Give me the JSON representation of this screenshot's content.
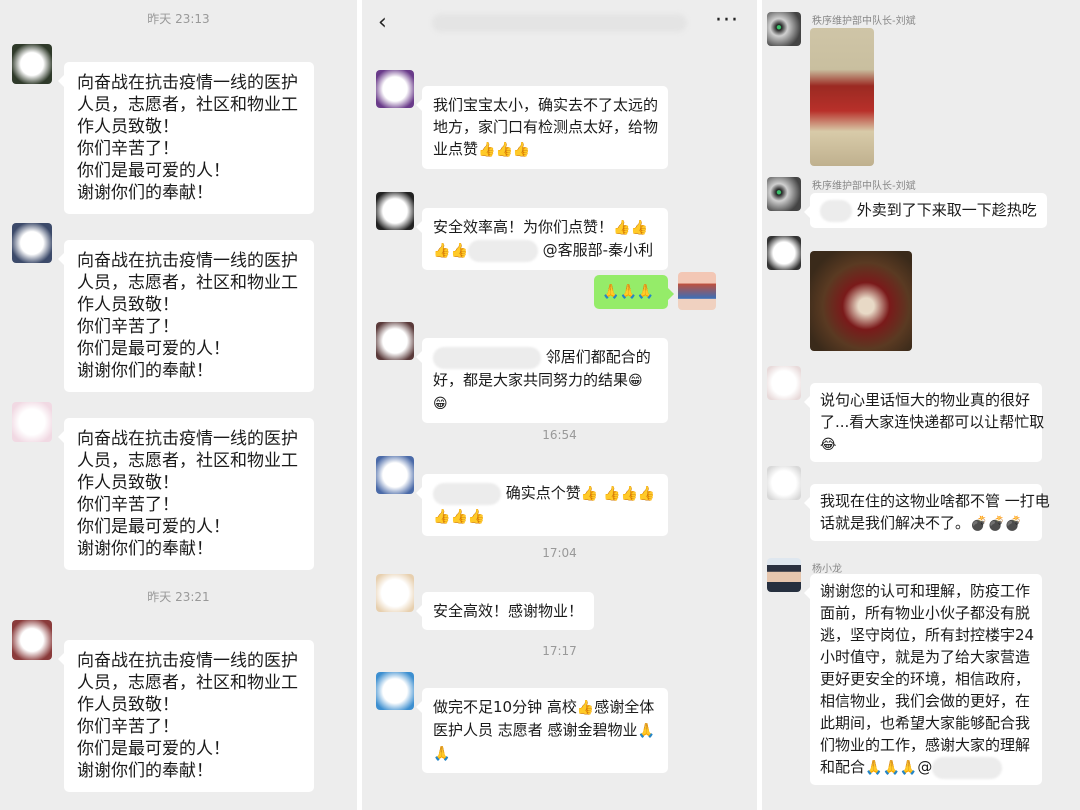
{
  "panel1": {
    "timestamps": [
      "昨天 23:13",
      "昨天 23:21"
    ],
    "message_lines": [
      "向奋战在抗击疫情一线的医护",
      "人员，志愿者，社区和物业工",
      "作人员致敬！",
      "你们辛苦了！",
      "你们是最可爱的人！",
      "谢谢你们的奉献！"
    ]
  },
  "panel2": {
    "header": {
      "back_icon": "‹",
      "more_icon": "···"
    },
    "messages": {
      "m1": [
        "我们宝宝太小，确实去不了太远的",
        "地方，家门口有检测点太好，给物",
        "业点赞"
      ],
      "m2a": "安全效率高！为你们点赞！",
      "m2b": "@客服部-秦小利",
      "m3a": "邻居们都配合的",
      "m3b": "好，都是大家共同努力的结果",
      "m4": "确实点个赞",
      "m5": "安全高效！感谢物业！",
      "m6a": "做完不足10分钟 高校",
      "m6b": "感谢全体",
      "m6c": "医护人员 志愿者 感谢金碧物业"
    },
    "timestamps": [
      "16:54",
      "17:04",
      "17:17"
    ],
    "emoji": {
      "thumbs": "👍",
      "pray": "🙏",
      "grin": "😁"
    }
  },
  "panel3": {
    "senders": {
      "liubin": "秩序维护部中队长-刘斌",
      "yang": "杨小龙"
    },
    "messages": {
      "m1": "外卖到了下来取一下趁热吃",
      "m2": [
        "说句心里话恒大的物业真的很好",
        "了...看大家连快递都可以让帮忙取"
      ],
      "m3": [
        "我现在住的这物业啥都不管 一打电",
        "话就是我们解决不了。"
      ],
      "m4": [
        "谢谢您的认可和理解，防疫工作",
        "面前，所有物业小伙子都没有脱",
        "逃，坚守岗位，所有封控楼宇24",
        "小时值守，就是为了给大家营造",
        "更好更安全的环境，相信政府，",
        "相信物业，我们会做的更好，在",
        "此期间，也希望大家能够配合我",
        "们物业的工作，感谢大家的理解",
        "和配合"
      ]
    },
    "emoji": {
      "cry_laugh": "😂",
      "bomb": "💣",
      "pray": "🙏"
    }
  }
}
